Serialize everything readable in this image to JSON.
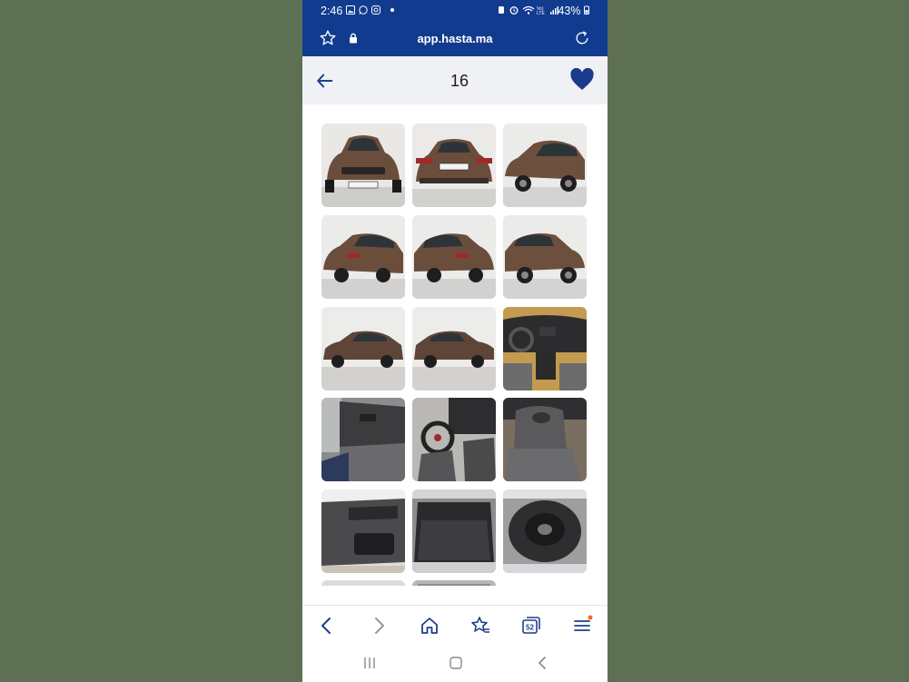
{
  "status_bar": {
    "time": "2:46",
    "battery": "43%",
    "network_label": "Vo) LTE1"
  },
  "browser": {
    "url": "app.hasta.ma",
    "tabs_count": "52"
  },
  "header": {
    "photo_count": "16"
  },
  "photos": [
    {
      "name": "photo-front"
    },
    {
      "name": "photo-rear"
    },
    {
      "name": "photo-front-three-quarter"
    },
    {
      "name": "photo-rear-three-quarter-left"
    },
    {
      "name": "photo-rear-three-quarter-right"
    },
    {
      "name": "photo-front-three-quarter-right"
    },
    {
      "name": "photo-side-left"
    },
    {
      "name": "photo-side-right"
    },
    {
      "name": "photo-dashboard"
    },
    {
      "name": "photo-rear-seats"
    },
    {
      "name": "photo-driver-seat"
    },
    {
      "name": "photo-front-seat"
    },
    {
      "name": "photo-door-panel"
    },
    {
      "name": "photo-trunk"
    },
    {
      "name": "photo-spare-wheel"
    },
    {
      "name": "photo-partial-1"
    },
    {
      "name": "photo-partial-2"
    }
  ],
  "colors": {
    "brand": "#113b8f",
    "heart": "#1b3a8e",
    "background": "#5e7054"
  }
}
